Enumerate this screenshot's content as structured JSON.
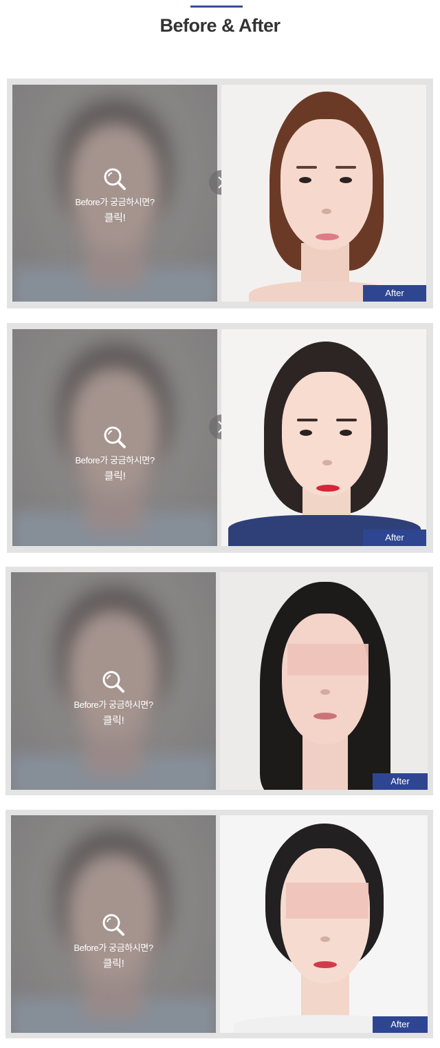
{
  "header": {
    "title": "Before & After"
  },
  "cases": [
    {
      "before_text": "Before가 궁금하시면?",
      "before_click": "클릭!",
      "after_label": "After"
    },
    {
      "before_text": "Before가 궁금하시면?",
      "before_click": "클릭!",
      "after_label": "After"
    },
    {
      "before_text": "Before가 궁금하시면?",
      "before_click": "클릭!",
      "after_label": "After"
    },
    {
      "before_text": "Before가 궁금하시면?",
      "before_click": "클릭!",
      "after_label": "After"
    }
  ],
  "colors": {
    "accent": "#2e4591",
    "header_line": "#3a4d96",
    "frame": "#e3e3e3"
  },
  "icons": {
    "before": "magnifier-icon",
    "next": "chevron-right-icon"
  }
}
